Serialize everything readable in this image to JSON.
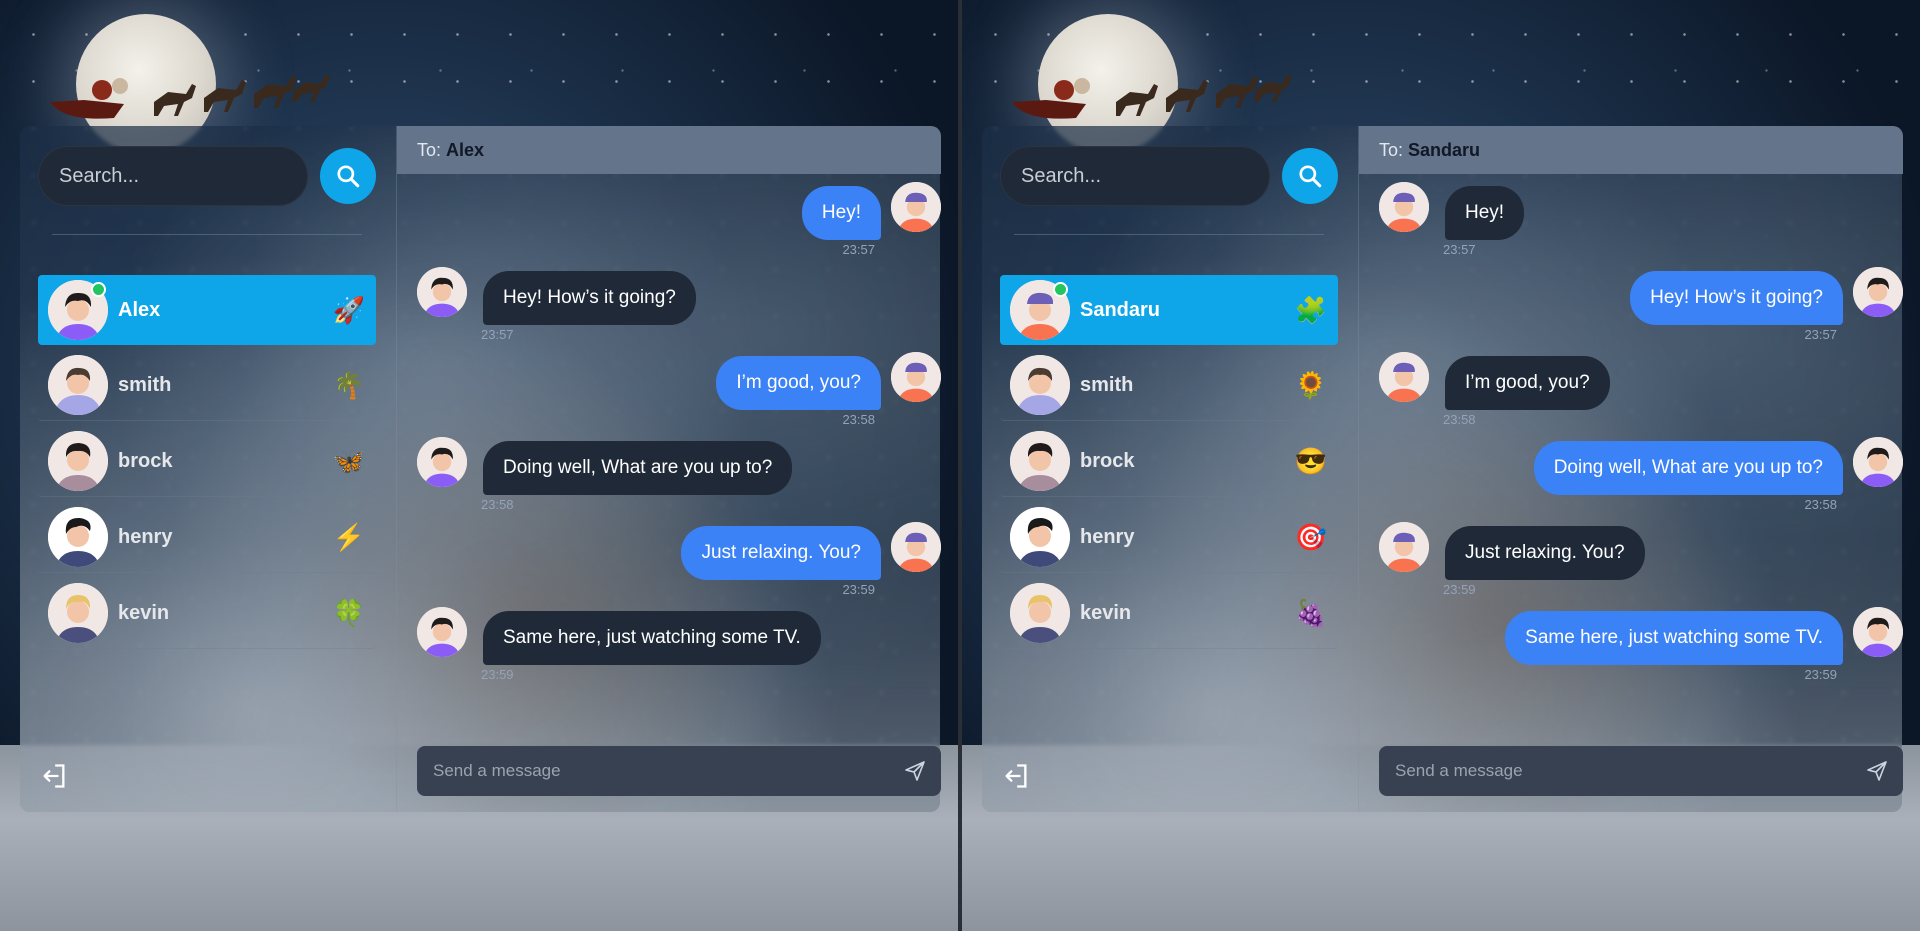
{
  "left": {
    "search": {
      "placeholder": "Search..."
    },
    "contacts": [
      {
        "name": "Alex",
        "emoji": "🚀",
        "active": true,
        "online": true,
        "avatar": "boy-purple-shirt"
      },
      {
        "name": "smith",
        "emoji": "🌴",
        "active": false,
        "online": false,
        "avatar": "boy-purple-hoodie"
      },
      {
        "name": "brock",
        "emoji": "🦋",
        "active": false,
        "online": false,
        "avatar": "boy-mauve-shirt"
      },
      {
        "name": "henry",
        "emoji": "⚡",
        "active": false,
        "online": false,
        "avatar": "boy-navy-shirt"
      },
      {
        "name": "kevin",
        "emoji": "🍀",
        "active": false,
        "online": false,
        "avatar": "boy-blonde"
      }
    ],
    "chat": {
      "to_label": "To:",
      "recipient": "Alex",
      "messages": [
        {
          "dir": "out",
          "text": "Hey!",
          "time": "23:57",
          "avatar": "boy-cap-orange"
        },
        {
          "dir": "in",
          "text": "Hey! How’s it going?",
          "time": "23:57",
          "avatar": "boy-purple-shirt"
        },
        {
          "dir": "out",
          "text": "I’m good, you?",
          "time": "23:58",
          "avatar": "boy-cap-orange"
        },
        {
          "dir": "in",
          "text": "Doing well, What are you up to?",
          "time": "23:58",
          "avatar": "boy-purple-shirt"
        },
        {
          "dir": "out",
          "text": "Just relaxing. You?",
          "time": "23:59",
          "avatar": "boy-cap-orange"
        },
        {
          "dir": "in",
          "text": "Same here, just watching some TV.",
          "time": "23:59",
          "avatar": "boy-purple-shirt"
        }
      ],
      "composer_placeholder": "Send a message"
    }
  },
  "right": {
    "search": {
      "placeholder": "Search..."
    },
    "contacts": [
      {
        "name": "Sandaru",
        "emoji": "🧩",
        "active": true,
        "online": true,
        "avatar": "boy-cap-orange"
      },
      {
        "name": "smith",
        "emoji": "🌻",
        "active": false,
        "online": false,
        "avatar": "boy-purple-hoodie"
      },
      {
        "name": "brock",
        "emoji": "😎",
        "active": false,
        "online": false,
        "avatar": "boy-mauve-shirt"
      },
      {
        "name": "henry",
        "emoji": "🎯",
        "active": false,
        "online": false,
        "avatar": "boy-navy-shirt"
      },
      {
        "name": "kevin",
        "emoji": "🍇",
        "active": false,
        "online": false,
        "avatar": "boy-blonde"
      }
    ],
    "chat": {
      "to_label": "To:",
      "recipient": "Sandaru",
      "messages": [
        {
          "dir": "in",
          "text": "Hey!",
          "time": "23:57",
          "avatar": "boy-cap-orange"
        },
        {
          "dir": "out",
          "text": "Hey! How’s it going?",
          "time": "23:57",
          "avatar": "boy-purple-shirt"
        },
        {
          "dir": "in",
          "text": "I’m good, you?",
          "time": "23:58",
          "avatar": "boy-cap-orange"
        },
        {
          "dir": "out",
          "text": "Doing well, What are you up to?",
          "time": "23:58",
          "avatar": "boy-purple-shirt"
        },
        {
          "dir": "in",
          "text": "Just relaxing. You?",
          "time": "23:59",
          "avatar": "boy-cap-orange"
        },
        {
          "dir": "out",
          "text": "Same here, just watching some TV.",
          "time": "23:59",
          "avatar": "boy-purple-shirt"
        }
      ],
      "composer_placeholder": "Send a message"
    }
  },
  "colors": {
    "accent": "#0ea5e9",
    "outgoing_bubble": "#3b82f6",
    "incoming_bubble": "#1f2937",
    "header": "#64748b",
    "online": "#22c55e"
  }
}
